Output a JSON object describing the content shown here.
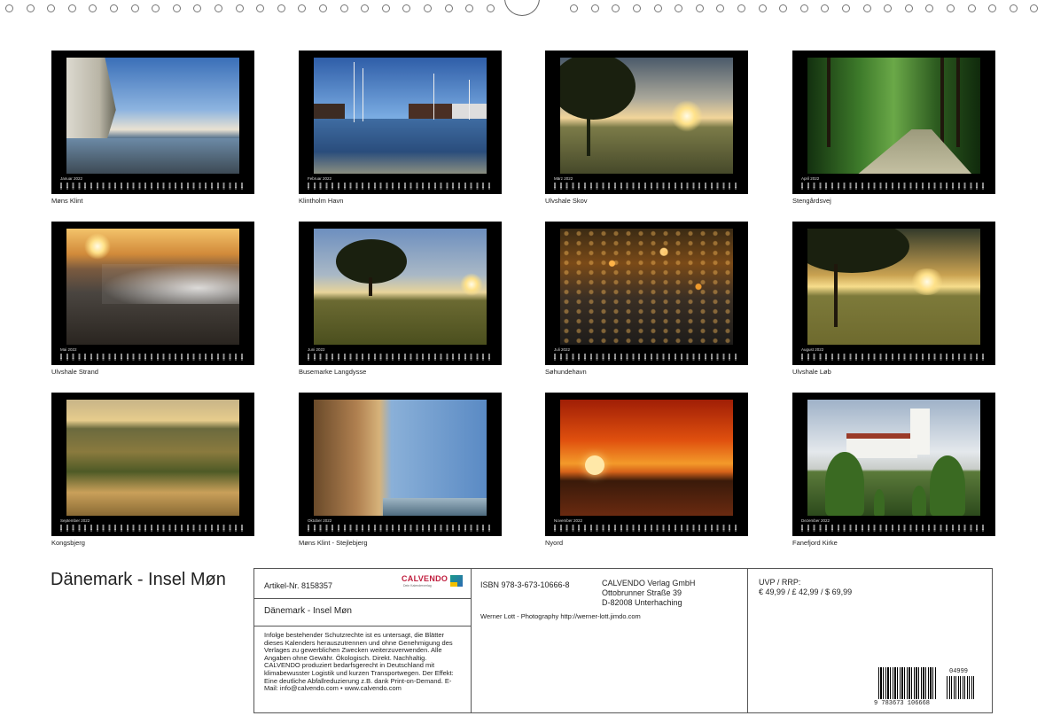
{
  "calendar": {
    "title": "Dänemark - Insel Møn",
    "months": [
      {
        "month": "Januar 2022",
        "caption": "Møns Klint"
      },
      {
        "month": "Februar 2022",
        "caption": "Klintholm Havn"
      },
      {
        "month": "März 2022",
        "caption": "Ulvshale Skov"
      },
      {
        "month": "April 2022",
        "caption": "Stengårdsvej"
      },
      {
        "month": "Mai 2022",
        "caption": "Ulvshale Strand"
      },
      {
        "month": "Juni 2022",
        "caption": "Busemarke Langdysse"
      },
      {
        "month": "Juli 2022",
        "caption": "Søhundehavn"
      },
      {
        "month": "August 2022",
        "caption": "Ulvshale Løb"
      },
      {
        "month": "September 2022",
        "caption": "Kongsbjerg"
      },
      {
        "month": "Oktober 2022",
        "caption": "Møns Klint - Stejlebjerg"
      },
      {
        "month": "November 2022",
        "caption": "Nyord"
      },
      {
        "month": "Dezember 2022",
        "caption": "Fanefjord Kirke"
      }
    ]
  },
  "info": {
    "article_no": "Artikel-Nr. 8158357",
    "logo_text": "CALVENDO",
    "logo_sub": "Dein Kalenderverlag",
    "product_title": "Dänemark - Insel Møn",
    "legal_text": "Infolge bestehender Schutzrechte ist es untersagt, die Blätter dieses Kalenders herauszutrennen und ohne Genehmigung des Verlages zu gewerblichen Zwecken weiterzuverwenden. Alle Angaben ohne Gewähr. Ökologisch. Direkt. Nachhaltig. CALVENDO produziert bedarfsgerecht in Deutschland mit klimabewusster Logistik und kurzen Transportwegen. Der Effekt: Eine deutliche Abfallreduzierung z.B. dank Print-on-Demand. E-Mail: info@calvendo.com • www.calvendo.com",
    "isbn": "ISBN 978-3-673-10666-8",
    "publisher_name": "CALVENDO Verlag GmbH",
    "publisher_street": "Ottobrunner Straße 39",
    "publisher_city": "D-82008 Unterhaching",
    "author": "Werner Lott - Photography http://werner-lott.jimdo.com",
    "price_label": "UVP / RRP:",
    "price_value": "€ 49,99 / £ 42,99 / $ 69,99",
    "barcode_number": "9  783673  106668",
    "barcode_addon": "04999"
  }
}
